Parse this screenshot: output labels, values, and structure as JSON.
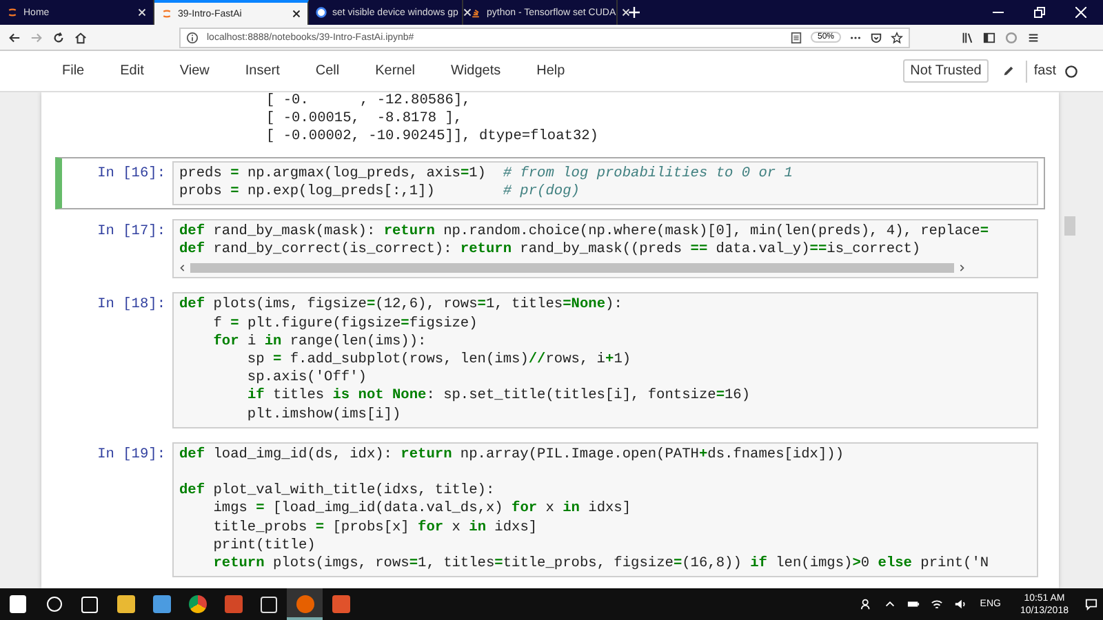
{
  "browser_tabs": [
    {
      "title": "Home",
      "selected": false
    },
    {
      "title": "39-Intro-FastAi",
      "selected": true
    },
    {
      "title": "set visible device windows gp",
      "selected": false
    },
    {
      "title": "python - Tensorflow set CUDA",
      "selected": false
    }
  ],
  "address_bar": {
    "url": "localhost:8888/notebooks/39-Intro-FastAi.ipynb#",
    "zoom": "50%"
  },
  "menu": [
    "File",
    "Edit",
    "View",
    "Insert",
    "Cell",
    "Kernel",
    "Widgets",
    "Help"
  ],
  "trust_status": "Not Trusted",
  "kernel_name": "fast",
  "output_lines": [
    "[ -0.      , -12.80586],",
    "[ -0.00015,  -8.8178 ],",
    "[ -0.00002, -10.90245]], dtype=float32)"
  ],
  "cells": [
    {
      "prompt": "In [16]:",
      "selected": true,
      "scrollbar": false,
      "blocks": [
        [
          "preds **=** np.argmax(log_preds, axis**=**1)  *# from log probabilities to 0 or 1*",
          "probs **=** np.exp(log_preds[:,1])        *# pr(dog)*"
        ]
      ]
    },
    {
      "prompt": "In [17]:",
      "selected": false,
      "scrollbar": true,
      "blocks": [
        [
          "**def** rand_by_mask(mask): **return** np.random.choice(np.where(mask)[0], min(len(preds), 4), replace**=**",
          "**def** rand_by_correct(is_correct): **return** rand_by_mask((preds **==** data.val_y)**==**is_correct)"
        ]
      ]
    },
    {
      "prompt": "In [18]:",
      "selected": false,
      "scrollbar": false,
      "blocks": [
        [
          "**def** plots(ims, figsize**=**(12,6), rows**=**1, titles**=None**):",
          "    f **=** plt.figure(figsize**=**figsize)",
          "    **for** i **in** range(len(ims)):",
          "        sp **=** f.add_subplot(rows, len(ims)**//**rows, i**+**1)",
          "        sp.axis('Off')",
          "        **if** titles **is not None**: sp.set_title(titles[i], fontsize**=**16)",
          "        plt.imshow(ims[i])"
        ]
      ]
    },
    {
      "prompt": "In [19]:",
      "selected": false,
      "scrollbar": false,
      "blocks": [
        [
          "**def** load_img_id(ds, idx): **return** np.array(PIL.Image.open(PATH**+**ds.fnames[idx]))"
        ],
        [
          "**def** plot_val_with_title(idxs, title):",
          "    imgs **=** [load_img_id(data.val_ds,x) **for** x **in** idxs]",
          "    title_probs **=** [probs[x] **for** x **in** idxs]",
          "    print(title)",
          "    **return** plots(imgs, rows**=**1, titles**=**title_probs, figsize**=**(16,8)) **if** len(imgs)**>**0 **else** print('N"
        ]
      ]
    }
  ],
  "taskbar": {
    "language": "ENG",
    "time": "10:51 AM",
    "date": "10/13/2018"
  }
}
